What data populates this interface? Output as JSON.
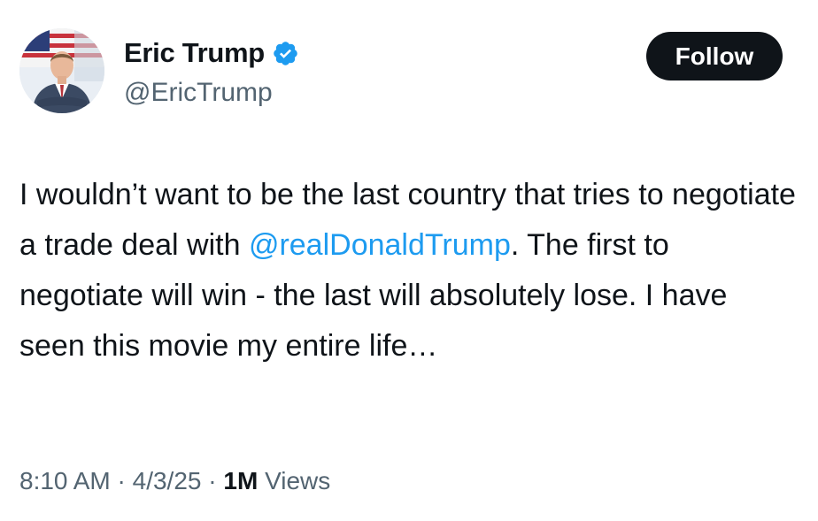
{
  "author": {
    "display_name": "Eric Trump",
    "handle": "@EricTrump",
    "verified": true,
    "verified_color": "#1d9bf0"
  },
  "follow_button": {
    "label": "Follow"
  },
  "tweet": {
    "text_before": "I wouldn’t want to be the last country that tries to negotiate a trade deal with ",
    "mention": "@realDonaldTrump",
    "text_after": ". The first to negotiate will win - the last will absolutely lose. I have seen this movie my entire life…",
    "mention_color": "#1d9bf0"
  },
  "meta": {
    "time": "8:10 AM",
    "separator": "·",
    "date": "4/3/25",
    "views_count": "1M",
    "views_label": "Views"
  }
}
